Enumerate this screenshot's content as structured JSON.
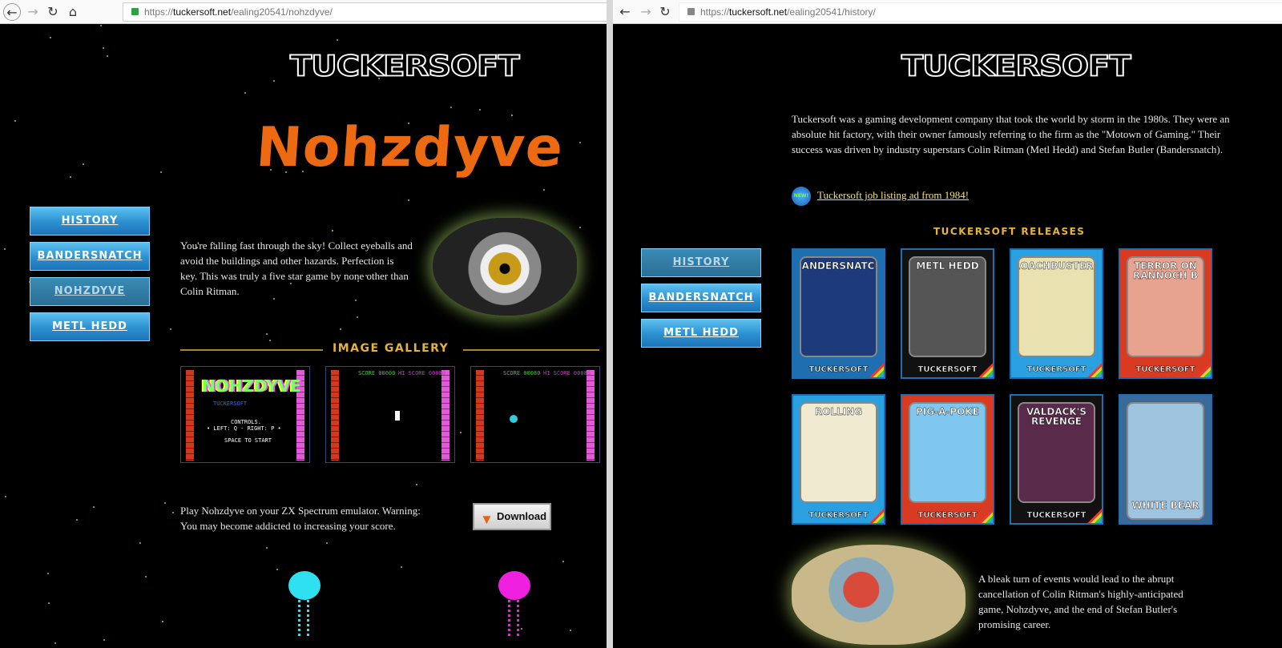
{
  "left_window": {
    "url": {
      "prefix": "https://",
      "domain": "tuckersoft.net",
      "path": "/ealing20541/nohzdyve/"
    },
    "logo": "TUCKERSOFT",
    "game_title": "Nohzdyve",
    "nav": [
      {
        "label": "HISTORY"
      },
      {
        "label": "BANDERSNATCH"
      },
      {
        "label": "NOHZDYVE",
        "active": true
      },
      {
        "label": "METL HEDD"
      }
    ],
    "description": "You're falling fast through the sky! Collect eyeballs and avoid the buildings and other hazards. Perfection is key. This was truly a five star game by none other than Colin Ritman.",
    "gallery_heading": "IMAGE GALLERY",
    "gallery": [
      {
        "lines": [
          "NOHZDYVE",
          "TUCKERSOFT",
          "CONTROLS.",
          "• LEFT: Q  -  RIGHT: P •",
          "SPACE TO START"
        ]
      },
      {
        "lines": [
          "SCORE 00000",
          "HI SCORE 00080"
        ]
      },
      {
        "lines": [
          "SCORE 00080",
          "HI SCORE 00080"
        ]
      }
    ],
    "play_text": "Play Nohzdyve on your ZX Spectrum emulator. Warning: You may become addicted to increasing your score.",
    "download_label": "Download"
  },
  "right_window": {
    "url": {
      "prefix": "https://",
      "domain": "tuckersoft.net",
      "path": "/ealing20541/history/"
    },
    "logo": "TUCKERSOFT",
    "intro": "Tuckersoft was a gaming development company that took the world by storm in the 1980s. They were an absolute hit factory, with their owner famously referring to the firm as the \"Motown of Gaming.\" Their success was driven by industry superstars Colin Ritman (Metl Hedd) and Stefan Butler (Bandersnatch).",
    "new_badge": "NEW!",
    "job_link": "Tuckersoft job listing ad from 1984!",
    "releases_heading": "TUCKERSOFT RELEASES",
    "nav": [
      {
        "label": "HISTORY",
        "active": true
      },
      {
        "label": "BANDERSNATCH"
      },
      {
        "label": "METL HEDD"
      }
    ],
    "releases": [
      {
        "title": "BANDERSNATCH",
        "brand": "TUCKERSOFT",
        "frame": "#1f6fb0",
        "art": "#1d3b7a"
      },
      {
        "title": "METL HEDD",
        "brand": "TUCKERSOFT",
        "frame": "#111111",
        "art": "#555555"
      },
      {
        "title": "ROACHBUSTERS",
        "brand": "TUCKERSOFT",
        "frame": "#2aa0e0",
        "art": "#e9e2b0"
      },
      {
        "title": "TERROR ON RANNOCH B",
        "brand": "TUCKERSOFT",
        "frame": "#d83a22",
        "art": "#e8a290"
      },
      {
        "title": "ROLLING",
        "brand": "TUCKERSOFT",
        "frame": "#2aa0e0",
        "art": "#f0ead0"
      },
      {
        "title": "PIG-A-POKE",
        "brand": "TUCKERSOFT",
        "frame": "#d83a22",
        "art": "#7fc7ef"
      },
      {
        "title": "VALDACK'S REVENGE",
        "brand": "TUCKERSOFT",
        "frame": "#111111",
        "art": "#5a2a4a"
      },
      {
        "title": "WHITE BEAR",
        "brand": "",
        "frame": "#3a6a9a",
        "art": "#9ec4e0"
      }
    ],
    "closing": "A bleak turn of events would lead to the abrupt cancellation of Colin Ritman's highly-anticipated game, Nohzdyve, and the end of Stefan Butler's promising career."
  },
  "colors": {
    "nav_button": "#2b8fd0",
    "gold": "#e5b437",
    "title_orange": "#ee6a12",
    "link": "#f3e27a"
  }
}
